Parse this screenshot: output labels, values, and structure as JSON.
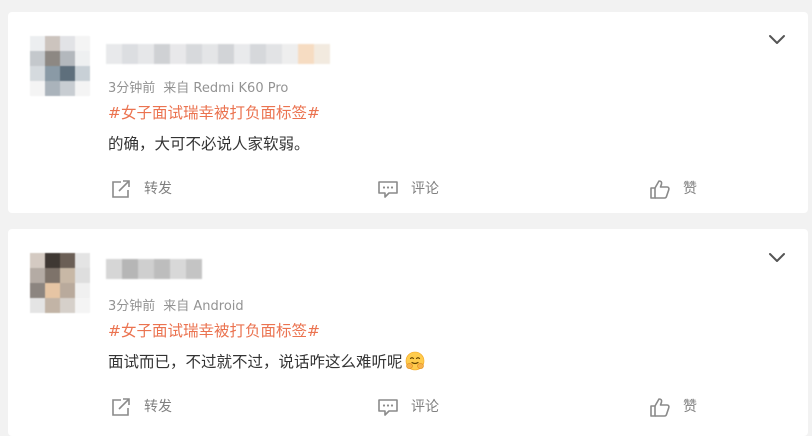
{
  "posts": [
    {
      "meta": {
        "time": "3分钟前",
        "source": "来自 Redmi K60 Pro"
      },
      "topic": "#女子面试瑞幸被打负面标签#",
      "content": "的确，大可不必说人家软弱。",
      "actions": {
        "repost": "转发",
        "comment": "评论",
        "like": "赞"
      }
    },
    {
      "meta": {
        "time": "3分钟前",
        "source": "来自 Android"
      },
      "topic": "#女子面试瑞幸被打负面标签#",
      "content": "面试而已，不过就不过，说话咋这么难听呢",
      "emoji": "hugging-face-emoji",
      "actions": {
        "repost": "转发",
        "comment": "评论",
        "like": "赞"
      }
    }
  ],
  "colors": {
    "topic": "#eb7350",
    "meta": "#939393",
    "text": "#333333",
    "action": "#808080",
    "background": "#f2f2f2",
    "card": "#ffffff"
  },
  "icons": {
    "more": "chevron-down-icon",
    "repost": "share-arrow-icon",
    "comment": "comment-bubble-icon",
    "like": "thumbs-up-icon"
  }
}
